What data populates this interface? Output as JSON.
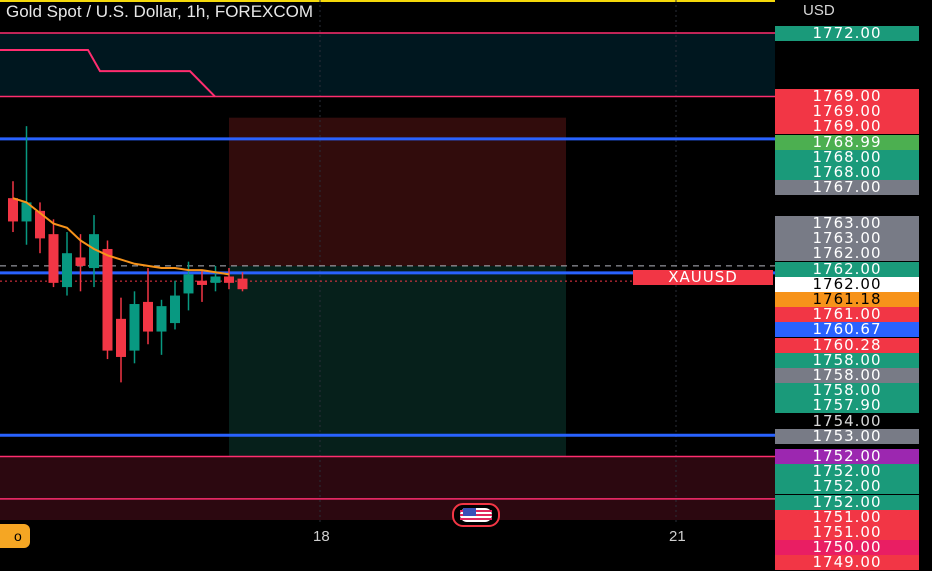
{
  "title": "Gold Spot / U.S. Dollar, 1h, FOREXCOM",
  "currency": "USD",
  "symbol": "XAUUSD",
  "left_badge": "o",
  "time_ticks": [
    {
      "label": "18"
    },
    {
      "label": "21"
    }
  ],
  "price_labels": [
    {
      "text": "1772.00",
      "price": 1772.0,
      "color": "#1a9a7a"
    },
    {
      "text": "1769.00",
      "price": 1769.0,
      "color": "#f23645"
    },
    {
      "text": "1769.00",
      "price": 1769.0,
      "color": "#f23645"
    },
    {
      "text": "1769.00",
      "price": 1769.0,
      "color": "#f23645"
    },
    {
      "text": "1768.99",
      "price": 1768.99,
      "color": "#4caf50"
    },
    {
      "text": "1768.00",
      "price": 1768.0,
      "color": "#1a9a7a"
    },
    {
      "text": "1768.00",
      "price": 1768.0,
      "color": "#1a9a7a"
    },
    {
      "text": "1767.00",
      "price": 1767.0,
      "color": "#787b86"
    },
    {
      "text": "1763.00",
      "price": 1763.0,
      "color": "#787b86"
    },
    {
      "text": "1763.00",
      "price": 1763.0,
      "color": "#787b86"
    },
    {
      "text": "1762.00",
      "price": 1762.0,
      "color": "#787b86"
    },
    {
      "text": "1762.00",
      "price": 1762.0,
      "color": "#1a9a7a"
    },
    {
      "text": "1762.00",
      "price": 1762.0,
      "color": "#ffffff",
      "textColor": "#000000"
    },
    {
      "text": "1761.18",
      "price": 1761.18,
      "color": "#f7931a",
      "textColor": "#000000"
    },
    {
      "text": "1761.00",
      "price": 1761.0,
      "color": "#f23645"
    },
    {
      "text": "1760.67",
      "price": 1760.67,
      "color": "#2962ff"
    },
    {
      "text": "1760.28",
      "price": 1760.28,
      "color": "#f23645"
    },
    {
      "text": "1758.00",
      "price": 1758.0,
      "color": "#1a9a7a"
    },
    {
      "text": "1758.00",
      "price": 1758.0,
      "color": "#787b86"
    },
    {
      "text": "1758.00",
      "price": 1758.0,
      "color": "#1a9a7a"
    },
    {
      "text": "1757.90",
      "price": 1757.9,
      "color": "#1a9a7a"
    },
    {
      "text": "1754.00",
      "price": 1754.0,
      "color": "transparent",
      "plain": true
    },
    {
      "text": "1753.00",
      "price": 1753.0,
      "color": "#787b86"
    },
    {
      "text": "1752.00",
      "price": 1752.0,
      "color": "#9c27b0"
    },
    {
      "text": "1752.00",
      "price": 1752.0,
      "color": "#1a9a7a"
    },
    {
      "text": "1752.00",
      "price": 1752.0,
      "color": "#1a9a7a"
    },
    {
      "text": "1752.00",
      "price": 1752.0,
      "color": "#1a9a7a"
    },
    {
      "text": "1751.00",
      "price": 1751.0,
      "color": "#f23645"
    },
    {
      "text": "1751.00",
      "price": 1751.0,
      "color": "#f23645"
    },
    {
      "text": "1750.00",
      "price": 1750.0,
      "color": "#e91e63"
    },
    {
      "text": "1749.00",
      "price": 1749.0,
      "color": "#f23645"
    }
  ],
  "candles": [
    {
      "o": 1764.2,
      "h": 1765.0,
      "l": 1762.6,
      "c": 1763.1
    },
    {
      "o": 1763.1,
      "h": 1767.6,
      "l": 1762.0,
      "c": 1764.0
    },
    {
      "o": 1763.6,
      "h": 1764.0,
      "l": 1761.6,
      "c": 1762.3
    },
    {
      "o": 1762.5,
      "h": 1763.2,
      "l": 1760.0,
      "c": 1760.2
    },
    {
      "o": 1760.0,
      "h": 1762.6,
      "l": 1759.6,
      "c": 1761.6
    },
    {
      "o": 1761.4,
      "h": 1762.5,
      "l": 1759.8,
      "c": 1761.0
    },
    {
      "o": 1760.9,
      "h": 1763.4,
      "l": 1760.0,
      "c": 1762.5
    },
    {
      "o": 1761.8,
      "h": 1762.2,
      "l": 1756.6,
      "c": 1757.0
    },
    {
      "o": 1758.5,
      "h": 1759.5,
      "l": 1755.5,
      "c": 1756.7
    },
    {
      "o": 1757.0,
      "h": 1759.8,
      "l": 1756.4,
      "c": 1759.2
    },
    {
      "o": 1759.3,
      "h": 1760.9,
      "l": 1757.3,
      "c": 1757.9
    },
    {
      "o": 1757.9,
      "h": 1759.4,
      "l": 1756.8,
      "c": 1759.1
    },
    {
      "o": 1758.3,
      "h": 1760.3,
      "l": 1758.0,
      "c": 1759.6
    },
    {
      "o": 1759.7,
      "h": 1761.2,
      "l": 1758.9,
      "c": 1760.6
    },
    {
      "o": 1760.3,
      "h": 1760.8,
      "l": 1759.3,
      "c": 1760.1
    },
    {
      "o": 1760.2,
      "h": 1761.0,
      "l": 1759.8,
      "c": 1760.5
    },
    {
      "o": 1760.5,
      "h": 1760.9,
      "l": 1759.9,
      "c": 1760.2
    },
    {
      "o": 1760.4,
      "h": 1760.7,
      "l": 1759.8,
      "c": 1759.9
    }
  ],
  "ma_line": [
    1764.2,
    1764.0,
    1763.5,
    1763.0,
    1762.8,
    1762.2,
    1761.8,
    1761.5,
    1761.3,
    1761.1,
    1761.0,
    1760.9,
    1760.9,
    1760.8,
    1760.8,
    1760.7,
    1760.6
  ],
  "horizontal_lines": [
    {
      "price": 1772.0,
      "color": "#ff2d6f",
      "width": 1.5
    },
    {
      "price": 1769.0,
      "color": "#ff2d6f",
      "width": 1.5
    },
    {
      "price": 1767.0,
      "color": "#2962ff",
      "width": 3
    },
    {
      "price": 1760.67,
      "color": "#2962ff",
      "width": 3
    },
    {
      "price": 1753.0,
      "color": "#2962ff",
      "width": 3
    },
    {
      "price": 1752.0,
      "color": "#ff2d6f",
      "width": 1.5
    },
    {
      "price": 1750.0,
      "color": "#ff2d6f",
      "width": 1.5
    }
  ],
  "dashed_line": {
    "price": 1761.0,
    "color": "#b2b5be"
  },
  "last_price_line": {
    "price": 1760.28,
    "color": "#f23645"
  },
  "position": {
    "entry": 1761.0,
    "stop": 1768.0,
    "target": 1752.0
  },
  "colors": {
    "up": "#089981",
    "down": "#f23645",
    "ma": "#f7931a",
    "accent": "#f5d90a",
    "zone_fill": "#4a0e1a"
  }
}
